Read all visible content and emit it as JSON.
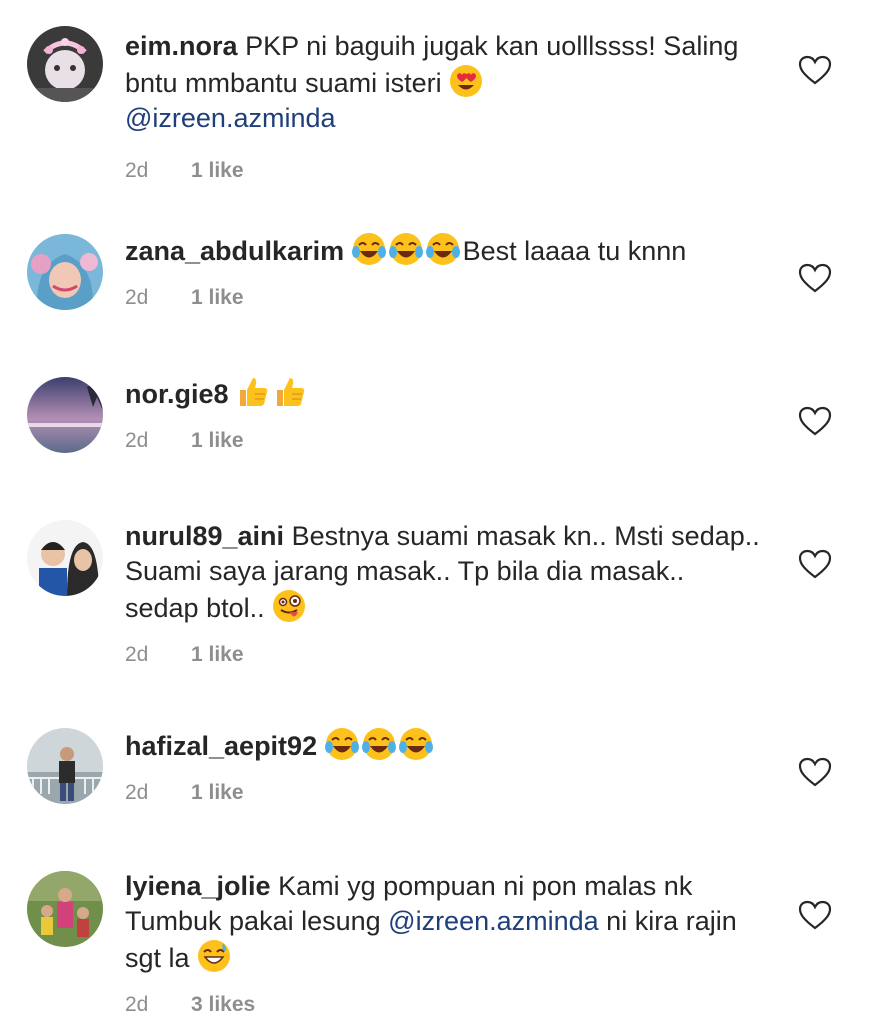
{
  "comments": [
    {
      "username": "eim.nora",
      "text_before": "PKP ni baguih jugak kan uolllssss! Saling bntu mmbantu suami isteri ",
      "emojis": [
        "heart-eyes"
      ],
      "line_break_after_emoji": true,
      "mention": "@izreen.azminda",
      "text_after": "",
      "time": "2d",
      "likes": "1 like"
    },
    {
      "username": "zana_abdulkarim",
      "text_before": "",
      "emojis": [
        "laughing-tears",
        "laughing-tears",
        "laughing-tears"
      ],
      "mention": "",
      "text_after": "Best laaaa tu knnn",
      "time": "2d",
      "likes": "1 like"
    },
    {
      "username": "nor.gie8",
      "text_before": "",
      "emojis": [
        "thumbs-up",
        "thumbs-up"
      ],
      "mention": "",
      "text_after": "",
      "time": "2d",
      "likes": "1 like"
    },
    {
      "username": "nurul89_aini",
      "text_before": "Bestnya suami masak kn.. Msti sedap.. Suami saya jarang masak.. Tp bila dia masak.. sedap btol.. ",
      "emojis": [
        "winking-tongue"
      ],
      "mention": "",
      "text_after": "",
      "time": "2d",
      "likes": "1 like"
    },
    {
      "username": "hafizal_aepit92",
      "text_before": "",
      "emojis": [
        "laughing-tears",
        "laughing-tears",
        "laughing-tears"
      ],
      "mention": "",
      "text_after": "",
      "time": "2d",
      "likes": "1 like"
    },
    {
      "username": "lyiena_jolie",
      "text_before": "Kami yg pompuan ni pon malas nk Tumbuk pakai lesung ",
      "emojis": [],
      "mention": "@izreen.azminda",
      "text_after": " ni kira rajin sgt la ",
      "trailing_emojis": [
        "grinning-sweat"
      ],
      "time": "2d",
      "likes": "3 likes"
    }
  ],
  "icons": {
    "like": "heart-outline-icon"
  },
  "colors": {
    "text": "#262626",
    "meta": "#8e8e8e",
    "mention": "#1f3f7a",
    "heart_stroke": "#262626"
  }
}
